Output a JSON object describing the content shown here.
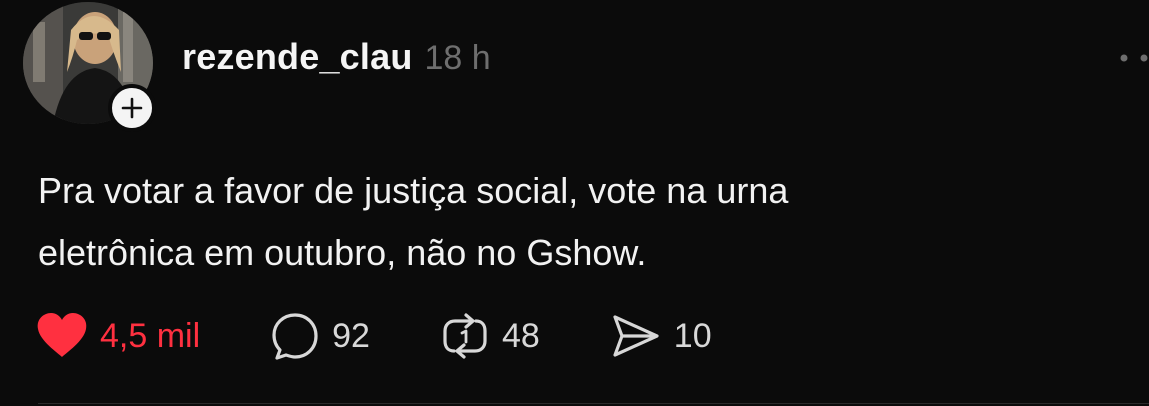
{
  "post": {
    "username": "rezende_clau",
    "time": "18 h",
    "text_lines": [
      "Pra votar a favor de justiça social, vote na urna",
      "eletrônica em outubro, não no Gshow."
    ]
  },
  "actions": {
    "likes": "4,5 mil",
    "replies": "92",
    "reposts": "48",
    "shares": "10"
  },
  "colors": {
    "background": "#0b0b0b",
    "like_red": "#ff3040",
    "muted_gray": "#6e6e6e"
  },
  "icons": [
    "plus-icon",
    "more-icon",
    "heart-icon",
    "comment-icon",
    "repost-icon",
    "send-icon"
  ]
}
